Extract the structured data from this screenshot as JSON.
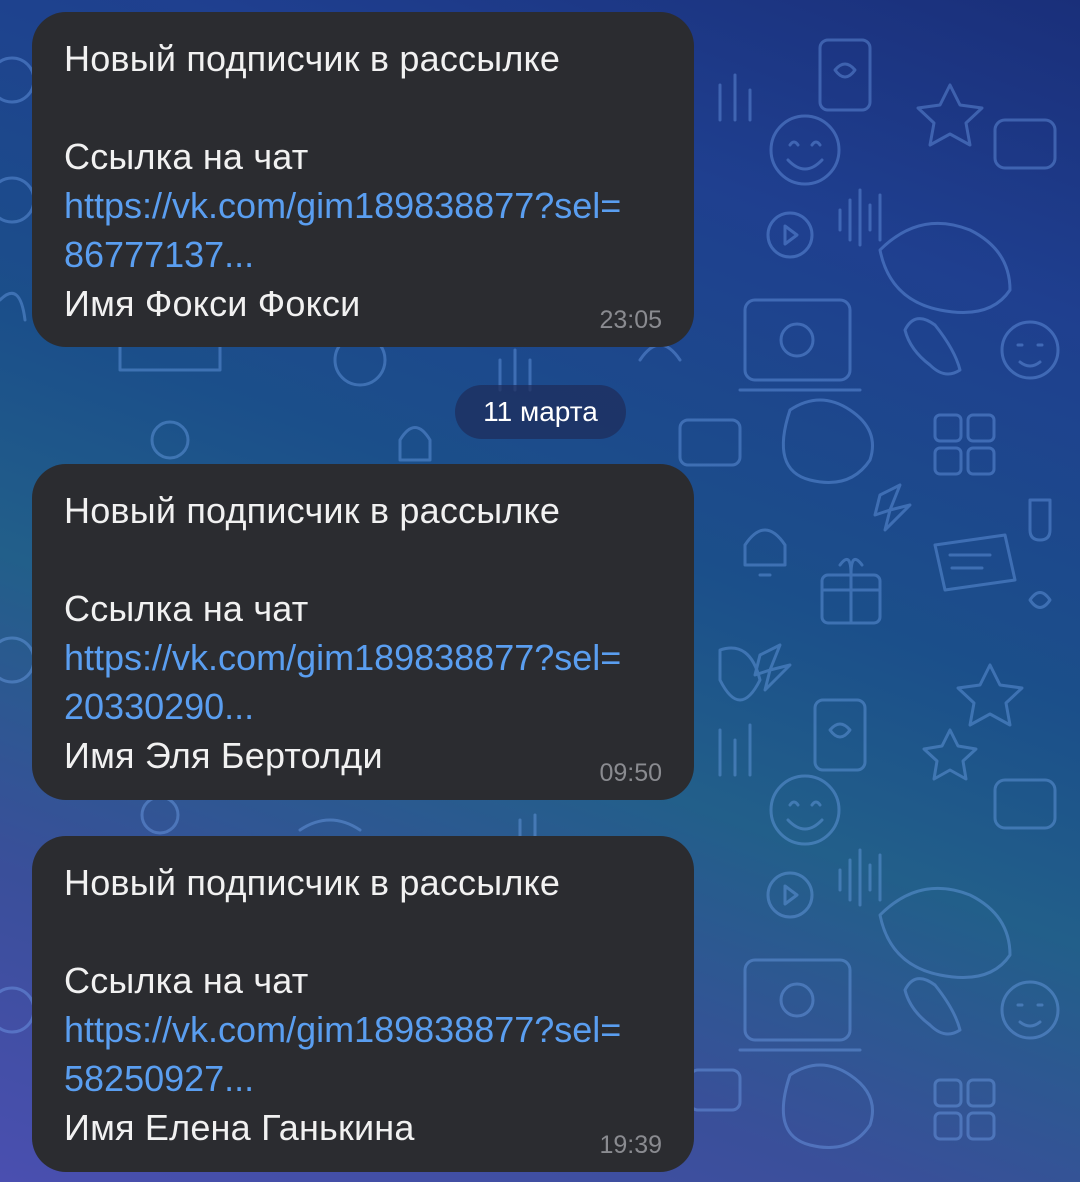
{
  "date_separator": "11 марта",
  "messages": [
    {
      "title": "Новый подписчик в рассылке",
      "link_label": "Ссылка на чат",
      "link_text": "https://vk.com/gim189838877?sel=\n86777137...",
      "name_line": "Имя Фокси Фокси",
      "time": "23:05"
    },
    {
      "title": "Новый подписчик в рассылке",
      "link_label": "Ссылка на чат",
      "link_text": "https://vk.com/gim189838877?sel=\n20330290...",
      "name_line": "Имя Эля Бертолди",
      "time": "09:50"
    },
    {
      "title": "Новый подписчик в рассылке",
      "link_label": "Ссылка на чат",
      "link_text": "https://vk.com/gim189838877?sel=\n58250927...",
      "name_line": "Имя Елена Ганькина",
      "time": "19:39"
    }
  ],
  "colors": {
    "bubble": "#2b2c30",
    "link": "#5a9ef0",
    "time": "#8a8b90"
  }
}
